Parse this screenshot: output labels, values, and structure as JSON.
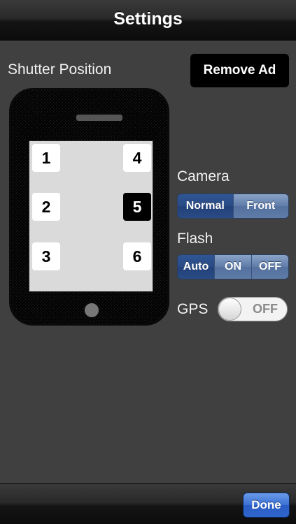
{
  "navbar": {
    "title": "Settings"
  },
  "shutter": {
    "label": "Shutter Position",
    "positions": [
      "1",
      "2",
      "3",
      "4",
      "5",
      "6"
    ],
    "selected": "5"
  },
  "remove_ad": {
    "label": "Remove Ad"
  },
  "camera": {
    "label": "Camera",
    "options": [
      "Normal",
      "Front"
    ],
    "selected": "Normal"
  },
  "flash": {
    "label": "Flash",
    "options": [
      "Auto",
      "ON",
      "OFF"
    ],
    "selected": "Auto"
  },
  "gps": {
    "label": "GPS",
    "state": "OFF"
  },
  "toolbar": {
    "done_label": "Done"
  }
}
